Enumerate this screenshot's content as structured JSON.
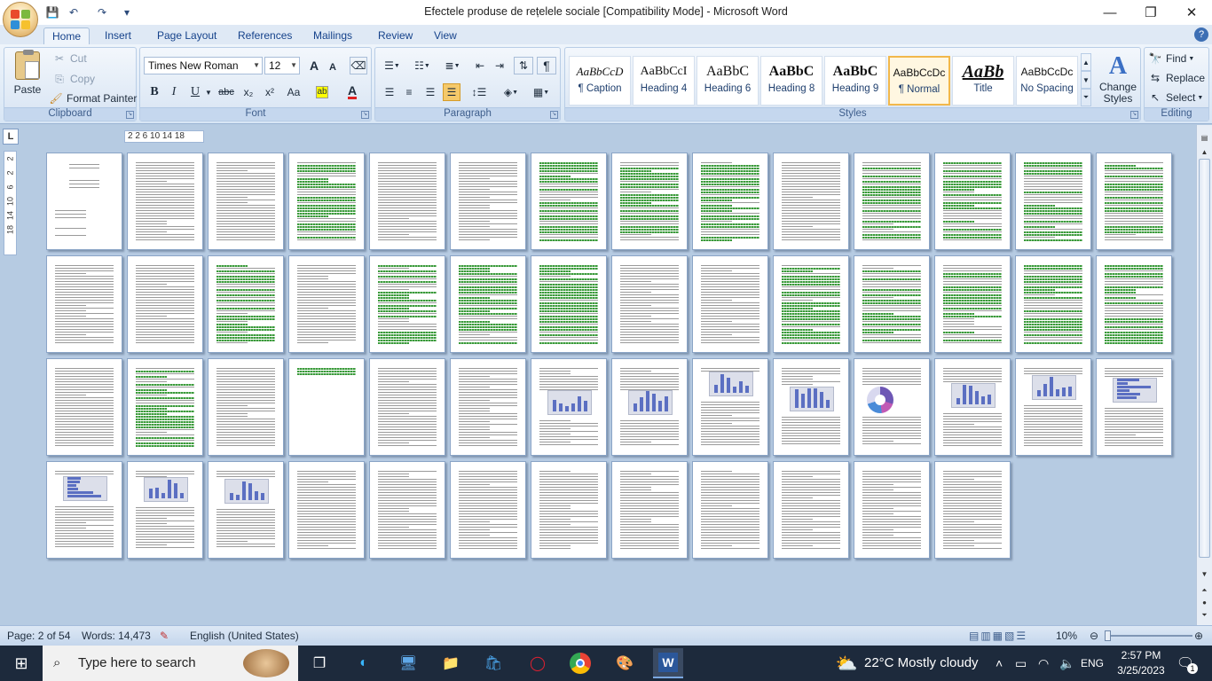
{
  "window": {
    "title": "Efectele produse de rețelele sociale  [Compatibility Mode] - Microsoft Word",
    "minimize": "—",
    "restore": "❐",
    "close": "✕"
  },
  "qat": {
    "save": "💾",
    "undo": "↶",
    "redo": "↷",
    "more": "▾"
  },
  "tabs": [
    {
      "label": "Home"
    },
    {
      "label": "Insert"
    },
    {
      "label": "Page Layout"
    },
    {
      "label": "References"
    },
    {
      "label": "Mailings"
    },
    {
      "label": "Review"
    },
    {
      "label": "View"
    }
  ],
  "help": "?",
  "clipboard": {
    "label": "Clipboard",
    "paste": "Paste",
    "cut": "Cut",
    "copy": "Copy",
    "format_painter": "Format Painter"
  },
  "font": {
    "label": "Font",
    "family": "Times New Roman",
    "size": "12",
    "grow": "A",
    "shrink": "A",
    "bold": "B",
    "italic": "I",
    "underline": "U",
    "strike": "abc",
    "subscript": "x₂",
    "superscript": "x²",
    "case": "Aa",
    "font_color": "A"
  },
  "paragraph": {
    "label": "Paragraph",
    "pilcrow": "¶"
  },
  "styles": {
    "label": "Styles",
    "items": [
      {
        "sample": "AaBbCcD",
        "name": "¶ Caption"
      },
      {
        "sample": "AaBbCcI",
        "name": "Heading 4"
      },
      {
        "sample": "AaBbC",
        "name": "Heading 6"
      },
      {
        "sample": "AaBbC",
        "name": "Heading 8"
      },
      {
        "sample": "AaBbC",
        "name": "Heading 9"
      },
      {
        "sample": "AaBbCcDc",
        "name": "¶ Normal"
      },
      {
        "sample": "AaBb",
        "name": "Title"
      },
      {
        "sample": "AaBbCcDc",
        "name": "No Spacing"
      }
    ],
    "change_styles": "Change Styles"
  },
  "editing": {
    "label": "Editing",
    "find": "Find",
    "replace": "Replace",
    "select": "Select"
  },
  "ruler": {
    "corner": "L",
    "marks": "2   2   6   10  14  18",
    "vertical": [
      "2",
      "2",
      "6",
      "10",
      "14",
      "18"
    ]
  },
  "status": {
    "page": "Page: 2 of 54",
    "words": "Words: 14,473",
    "language": "English (United States)",
    "zoom": "10%"
  },
  "taskbar": {
    "search_placeholder": "Type here to search",
    "weather": "22°C  Mostly cloudy",
    "lang": "ENG",
    "time": "2:57 PM",
    "date": "3/25/2023",
    "notifications": "1"
  },
  "colors": {
    "accent": "#15428b",
    "ribbon_bg": "#dde8f5",
    "doc_bg": "#b6cbe2",
    "highlight_green": "#3a9a3a",
    "selected_style": "#f2b84b"
  },
  "document": {
    "page_count": 54
  }
}
